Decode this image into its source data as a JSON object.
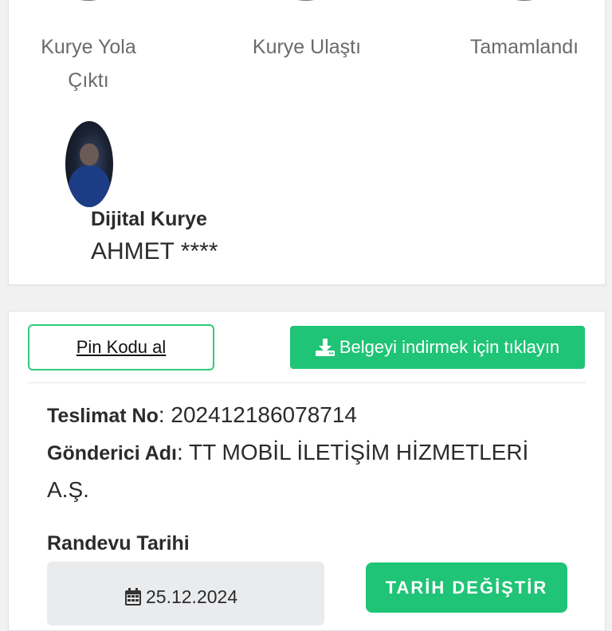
{
  "status_steps": [
    {
      "label_line1": "Kurye Yola",
      "label_line2": "Çıktı"
    },
    {
      "label_line1": "Kurye Ulaştı",
      "label_line2": ""
    },
    {
      "label_line1": "Tamamlandı",
      "label_line2": ""
    }
  ],
  "courier": {
    "title": "Dijital Kurye",
    "name": "AHMET ****"
  },
  "actions": {
    "pin_label": "Pin Kodu al",
    "download_label": "Belgeyi indirmek için tıklayın"
  },
  "delivery": {
    "delivery_no_label": "Teslimat No",
    "delivery_no_value": ": 202412186078714",
    "sender_label": "Gönderici Adı",
    "sender_value": ": TT MOBİL İLETİŞİM HİZMETLERİ A.Ş."
  },
  "appointment": {
    "label": "Randevu Tarihi",
    "date": "25.12.2024",
    "change_label": "TARİH DEĞİŞTİR"
  },
  "colors": {
    "accent_green": "#1fc476",
    "outline_green": "#2ecc7a"
  },
  "icons": {
    "download": "download-icon",
    "calendar": "calendar-icon"
  }
}
